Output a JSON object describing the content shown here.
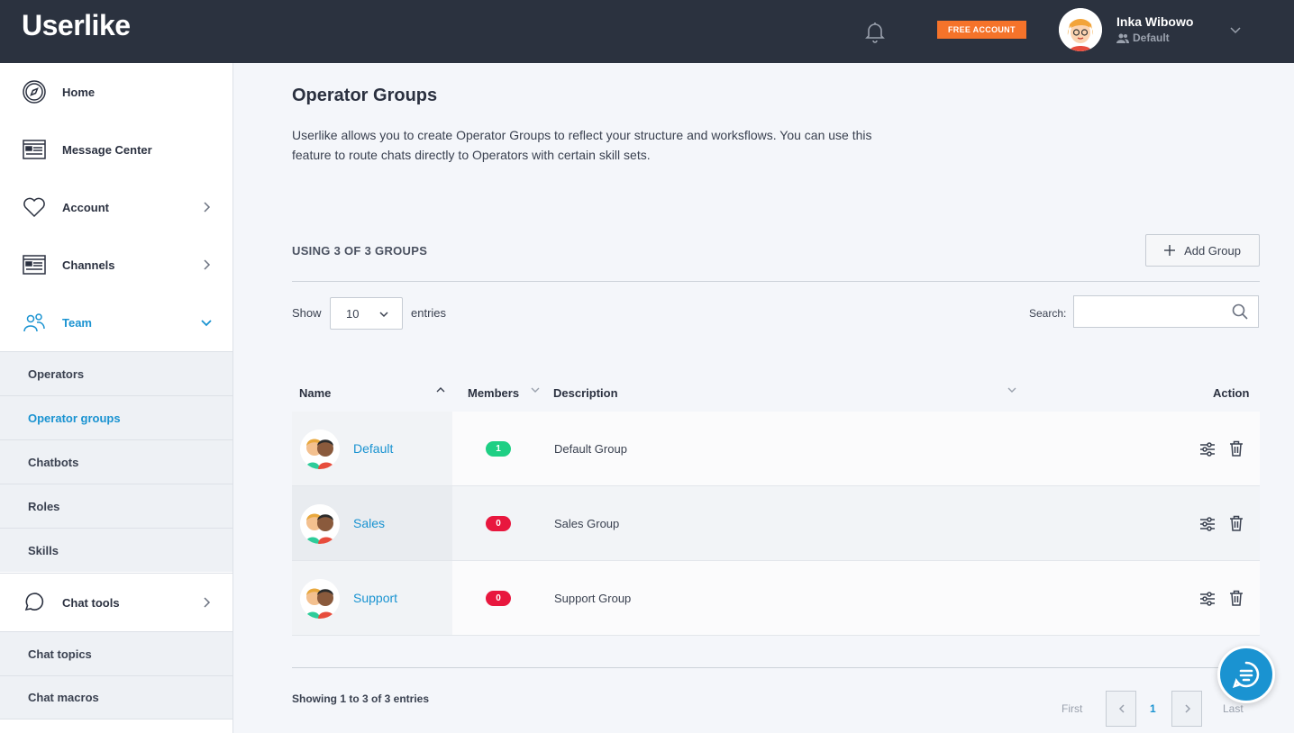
{
  "header": {
    "logo_text": "Userlike",
    "badge": "FREE ACCOUNT",
    "user": {
      "name": "Inka Wibowo",
      "role": "Default"
    }
  },
  "sidebar": {
    "items": [
      {
        "label": "Home",
        "icon": "compass-icon"
      },
      {
        "label": "Message Center",
        "icon": "message-center-icon"
      },
      {
        "label": "Account",
        "icon": "heart-icon"
      },
      {
        "label": "Channels",
        "icon": "channels-icon"
      },
      {
        "label": "Team",
        "icon": "team-icon"
      }
    ],
    "team_sub": [
      "Operators",
      "Operator groups",
      "Chatbots",
      "Roles",
      "Skills"
    ],
    "chat_tools": {
      "label": "Chat tools",
      "icon": "chat-bubble-icon"
    },
    "chat_tools_sub": [
      "Chat topics",
      "Chat macros"
    ]
  },
  "main": {
    "title": "Operator Groups",
    "description": "Userlike allows you to create Operator Groups to reflect your structure and worksflows. You can use this feature to route chats directly to Operators with certain skill sets.",
    "usage": "USING 3 OF 3 GROUPS",
    "add_button": "Add Group",
    "show_label": "Show",
    "entries_value": "10",
    "entries_label": "entries",
    "search_label": "Search:",
    "search_value": "",
    "columns": {
      "name": "Name",
      "members": "Members",
      "description": "Description",
      "action": "Action"
    },
    "rows": [
      {
        "name": "Default",
        "members": "1",
        "description": "Default Group",
        "badge_color": "#1ecf84"
      },
      {
        "name": "Sales",
        "members": "0",
        "description": "Sales Group",
        "badge_color": "#e8173e"
      },
      {
        "name": "Support",
        "members": "0",
        "description": "Support Group",
        "badge_color": "#e8173e"
      }
    ],
    "showing": "Showing 1 to 3 of 3 entries",
    "pagination": {
      "first": "First",
      "current": "1",
      "last": "Last"
    }
  },
  "colors": {
    "accent": "#1a93d1",
    "header_bg": "#2b323f",
    "badge_orange": "#f5732a"
  }
}
